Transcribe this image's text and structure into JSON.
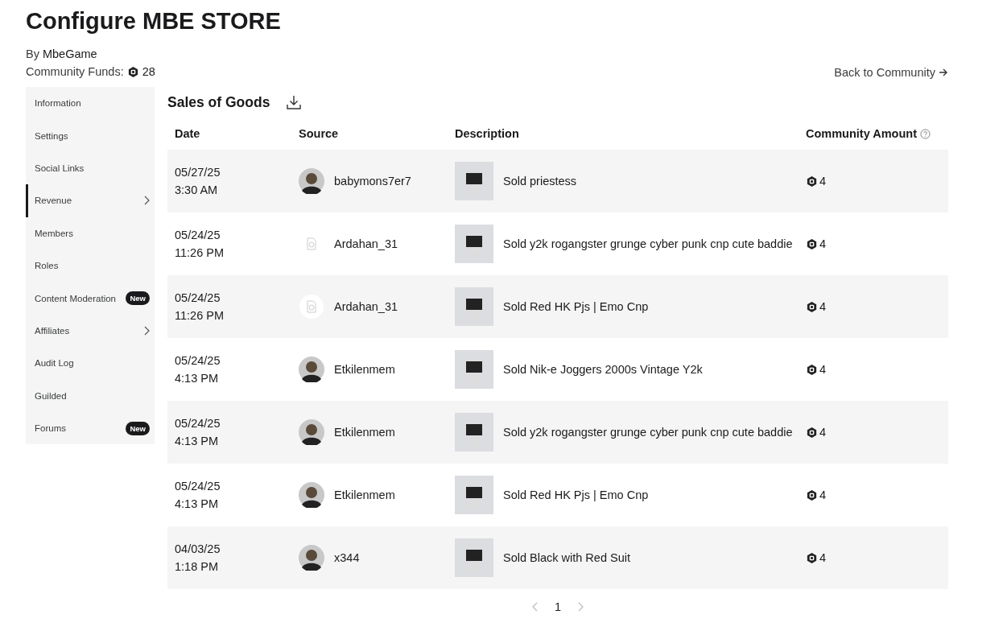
{
  "header": {
    "title": "Configure MBE STORE",
    "by_label": "By",
    "owner": "MbeGame",
    "funds_label": "Community Funds:",
    "funds": "28",
    "back_link": "Back to Community"
  },
  "sidebar": {
    "items": [
      {
        "label": "Information",
        "selected": false,
        "expandable": false
      },
      {
        "label": "Settings",
        "selected": false,
        "expandable": false
      },
      {
        "label": "Social Links",
        "selected": false,
        "expandable": false
      },
      {
        "label": "Revenue",
        "selected": true,
        "expandable": true
      },
      {
        "label": "Members",
        "selected": false,
        "expandable": false
      },
      {
        "label": "Roles",
        "selected": false,
        "expandable": false
      },
      {
        "label": "Content Moderation",
        "selected": false,
        "expandable": false,
        "badge": "New"
      },
      {
        "label": "Affiliates",
        "selected": false,
        "expandable": true
      },
      {
        "label": "Audit Log",
        "selected": false,
        "expandable": false
      },
      {
        "label": "Guilded",
        "selected": false,
        "expandable": false
      },
      {
        "label": "Forums",
        "selected": false,
        "expandable": false,
        "badge": "New"
      }
    ]
  },
  "section": {
    "title": "Sales of Goods"
  },
  "table": {
    "columns": [
      "Date",
      "Source",
      "Description",
      "Community Amount"
    ],
    "rows": [
      {
        "date": "05/27/25",
        "time": "3:30 AM",
        "source": "babymons7er7",
        "avatar": {
          "kind": "photo"
        },
        "description": "Sold priestess",
        "amount": "4"
      },
      {
        "date": "05/24/25",
        "time": "11:26 PM",
        "source": "Ardahan_31",
        "avatar": {
          "kind": "missing"
        },
        "description": "Sold y2k rogangster grunge cyber punk cnp cute baddie",
        "amount": "4"
      },
      {
        "date": "05/24/25",
        "time": "11:26 PM",
        "source": "Ardahan_31",
        "avatar": {
          "kind": "missing"
        },
        "description": "Sold Red HK Pjs | Emo Cnp",
        "amount": "4"
      },
      {
        "date": "05/24/25",
        "time": "4:13 PM",
        "source": "Etkilenmem",
        "avatar": {
          "kind": "photo"
        },
        "description": "Sold Nik-e Joggers 2000s Vintage Y2k",
        "amount": "4"
      },
      {
        "date": "05/24/25",
        "time": "4:13 PM",
        "source": "Etkilenmem",
        "avatar": {
          "kind": "photo"
        },
        "description": "Sold y2k rogangster grunge cyber punk cnp cute baddie",
        "amount": "4"
      },
      {
        "date": "05/24/25",
        "time": "4:13 PM",
        "source": "Etkilenmem",
        "avatar": {
          "kind": "photo"
        },
        "description": "Sold Red HK Pjs | Emo Cnp",
        "amount": "4"
      },
      {
        "date": "04/03/25",
        "time": "1:18 PM",
        "source": "x344",
        "avatar": {
          "kind": "photo"
        },
        "description": "Sold Black with Red Suit",
        "amount": "4"
      }
    ]
  },
  "pagination": {
    "page": "1"
  }
}
